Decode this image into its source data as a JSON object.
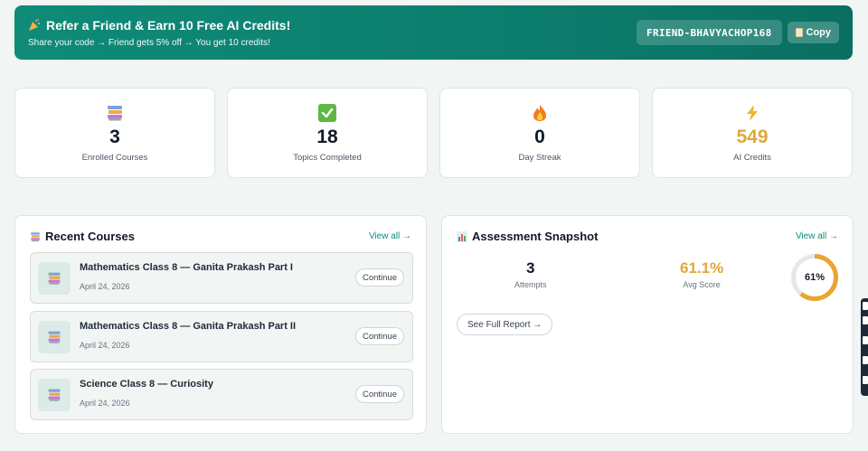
{
  "banner": {
    "title": "Refer a Friend & Earn 10 Free AI Credits!",
    "subtitle": "Share your code → Friend gets 5% off → You get 10 credits!",
    "referral_code": "FRIEND-BHAVYACHOP168",
    "copy_label": "Copy"
  },
  "stats": [
    {
      "icon": "books-icon",
      "value": "3",
      "label": "Enrolled Courses"
    },
    {
      "icon": "check-icon",
      "value": "18",
      "label": "Topics Completed"
    },
    {
      "icon": "fire-icon",
      "value": "0",
      "label": "Day Streak"
    },
    {
      "icon": "lightning-icon",
      "value": "549",
      "label": "AI Credits"
    }
  ],
  "recent_courses": {
    "title": "Recent Courses",
    "view_all": "View all →",
    "items": [
      {
        "name": "Mathematics Class 8 — Ganita Prakash Part I",
        "date": "April 24, 2026",
        "action": "Continue"
      },
      {
        "name": "Mathematics Class 8 — Ganita Prakash Part II",
        "date": "April 24, 2026",
        "action": "Continue"
      },
      {
        "name": "Science Class 8 — Curiosity",
        "date": "April 24, 2026",
        "action": "Continue"
      }
    ]
  },
  "assessment": {
    "title": "Assessment Snapshot",
    "view_all": "View all →",
    "attempts_value": "3",
    "attempts_label": "Attempts",
    "avg_score_value": "61.1%",
    "avg_score_label": "Avg Score",
    "progress_label": "61%",
    "progress_fraction": 0.61,
    "report_button": "See Full Report →"
  },
  "colors": {
    "accent": "#0f8b78",
    "gold": "#e0a83a",
    "ring": "#e8a532"
  }
}
